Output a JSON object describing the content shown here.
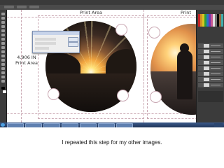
{
  "canvas": {
    "print_area_left": "Print Area",
    "print_area_right": "Print",
    "size_label_line1": "4.906 IN",
    "size_label_line2": "Print Area"
  },
  "caption": "I repeated this step for my other images.",
  "icons": {
    "start": "windows-start-icon"
  },
  "colors": {
    "guide": "#c9a7b2",
    "workspace": "#2a2a2a",
    "taskbar": "#2b4670"
  }
}
